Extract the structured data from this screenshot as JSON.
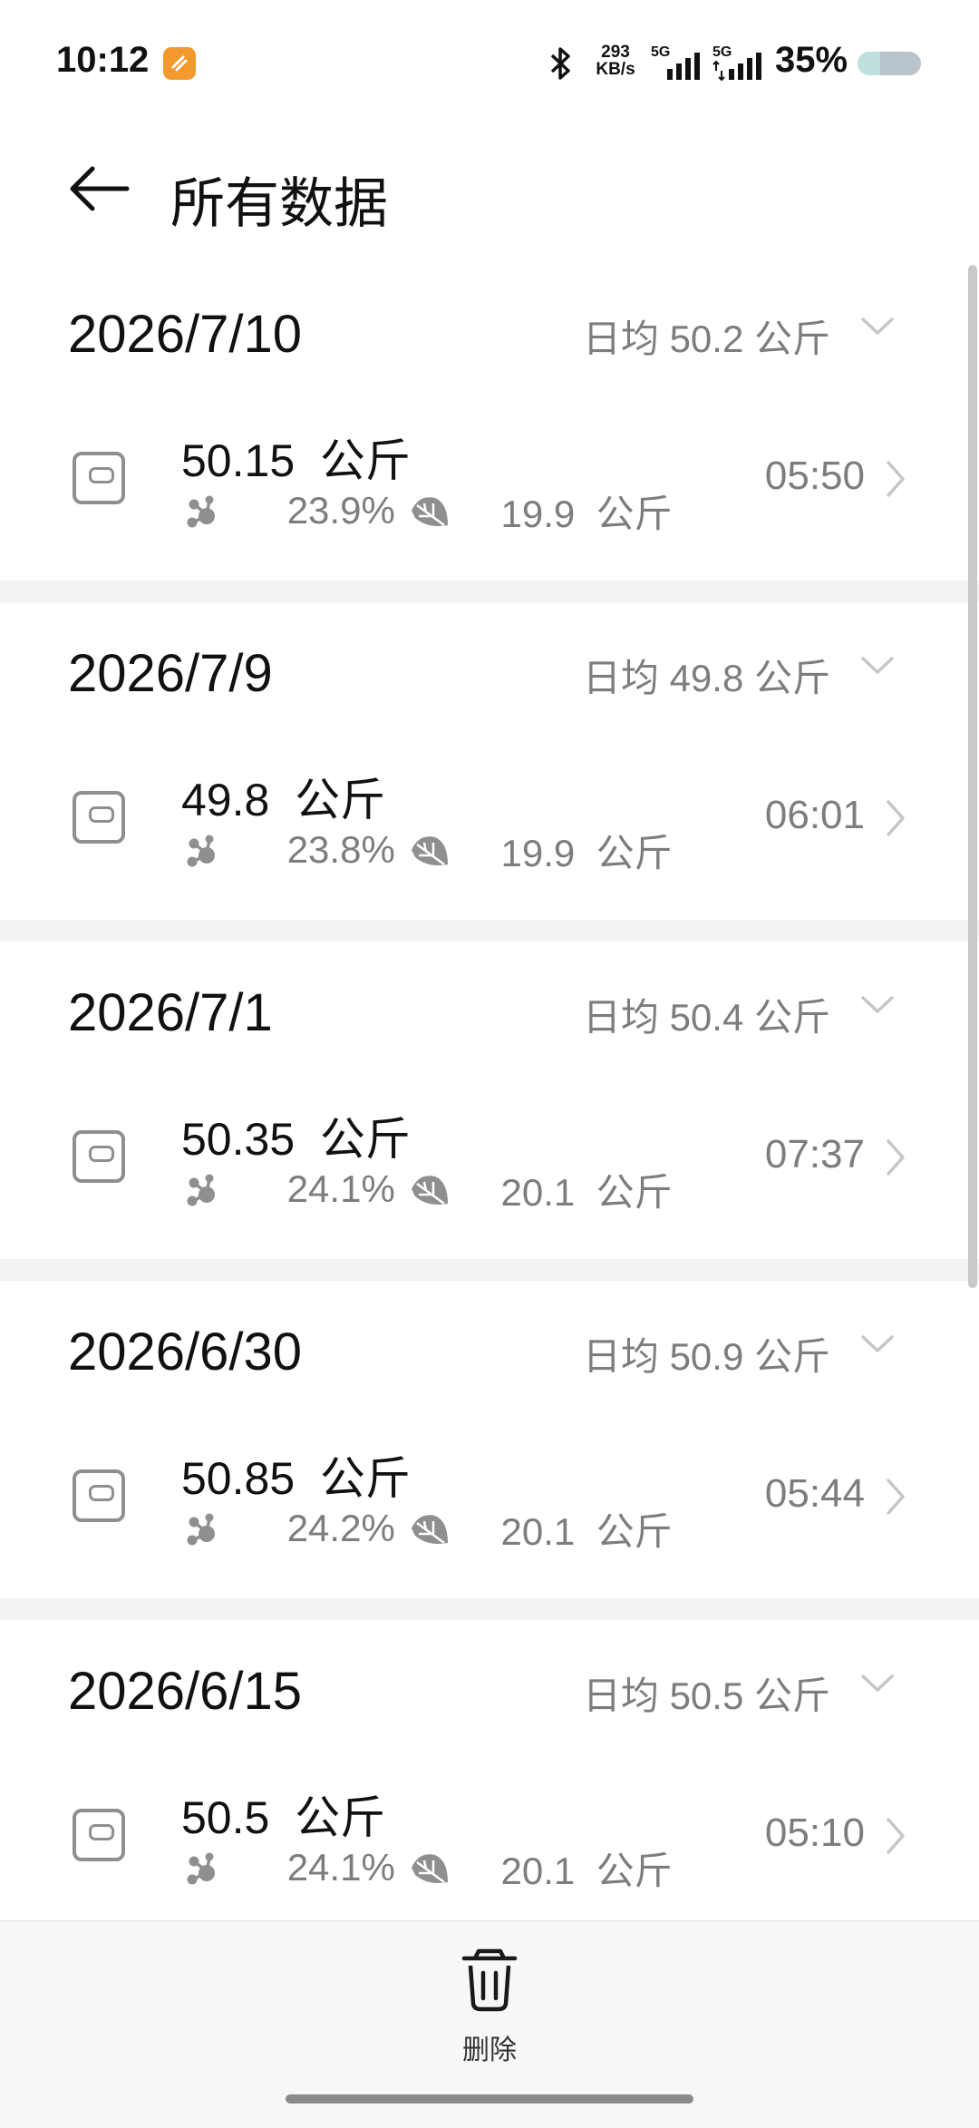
{
  "status_bar": {
    "time": "10:12",
    "net_speed_value": "293",
    "net_speed_unit": "KB/s",
    "signal1_label": "5G",
    "signal2_label": "5G",
    "battery_percent": "35%",
    "battery_level": 0.35
  },
  "header": {
    "title": "所有数据"
  },
  "groups": [
    {
      "date": "2026/7/10",
      "daily_avg": "日均 50.2 公斤",
      "record": {
        "weight": "50.15  公斤",
        "body_fat": "23.9%",
        "muscle": "19.9  公斤",
        "time": "05:50"
      }
    },
    {
      "date": "2026/7/9",
      "daily_avg": "日均 49.8 公斤",
      "record": {
        "weight": "49.8  公斤",
        "body_fat": "23.8%",
        "muscle": "19.9  公斤",
        "time": "06:01"
      }
    },
    {
      "date": "2026/7/1",
      "daily_avg": "日均 50.4 公斤",
      "record": {
        "weight": "50.35  公斤",
        "body_fat": "24.1%",
        "muscle": "20.1  公斤",
        "time": "07:37"
      }
    },
    {
      "date": "2026/6/30",
      "daily_avg": "日均 50.9 公斤",
      "record": {
        "weight": "50.85  公斤",
        "body_fat": "24.2%",
        "muscle": "20.1  公斤",
        "time": "05:44"
      }
    },
    {
      "date": "2026/6/15",
      "daily_avg": "日均 50.5 公斤",
      "record": {
        "weight": "50.5  公斤",
        "body_fat": "24.1%",
        "muscle": "20.1  公斤",
        "time": "05:10"
      }
    }
  ],
  "bottom_bar": {
    "delete_label": "删除"
  },
  "icons": {
    "back": "arrow-left-icon",
    "scale": "scale-icon",
    "body_fat": "molecule-icon",
    "muscle": "leaf-icon",
    "expand": "chevron-down-icon",
    "open": "chevron-right-icon",
    "delete": "trash-icon"
  },
  "colors": {
    "battery_track": "#b8c3cc",
    "battery_fill": "#bfe0dc",
    "app_badge": "#f39a2e"
  }
}
